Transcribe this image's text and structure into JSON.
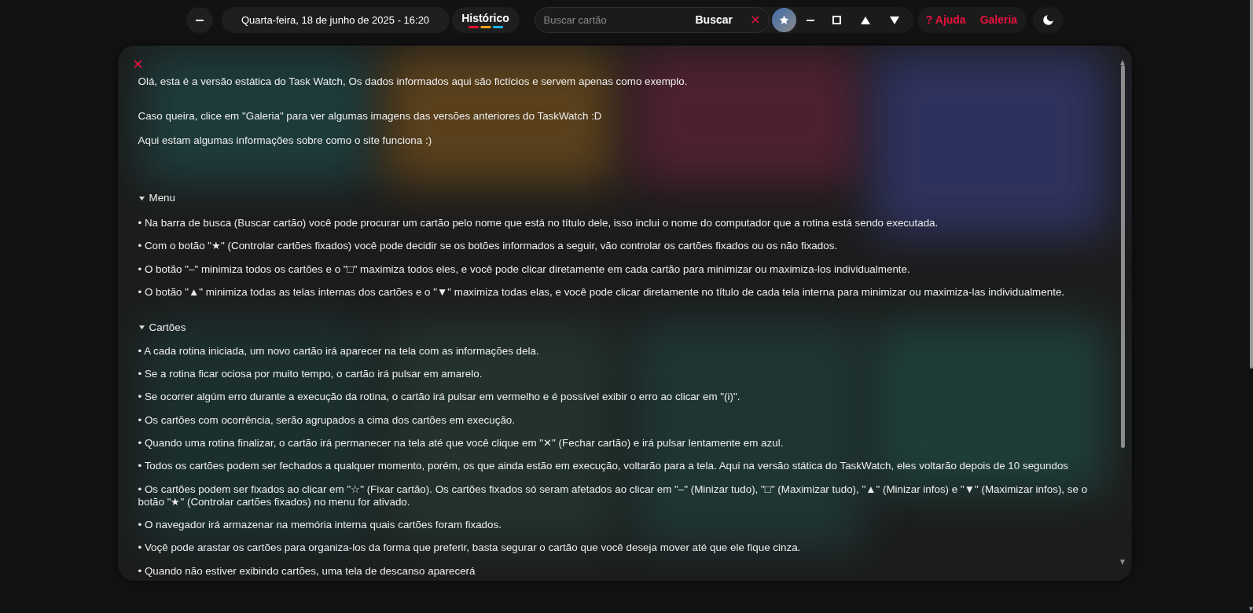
{
  "topbar": {
    "date": "Quarta-feira, 18 de junho de 2025 - 16:20",
    "history_button": "Histórico",
    "search": {
      "placeholder": "Buscar cartão",
      "button": "Buscar"
    },
    "help_link": "? Ajuda",
    "gallery_link": "Galeria"
  },
  "panel": {
    "intro": [
      "Olá, esta é a versão estática do Task Watch, Os dados informados aqui são fictícios e servem apenas como exemplo.",
      "Caso queira, clice em \"Galeria\" para ver algumas imagens das versões anteriores do TaskWatch :D",
      "Aqui estam algumas informações sobre como o site funciona :)"
    ],
    "sections": [
      {
        "title": "Menu",
        "expanded": true,
        "items": [
          "• Na barra de busca (Buscar cartão) você pode procurar um cartão pelo nome que está no título dele, isso inclui o nome do computador que a rotina está sendo executada.",
          "• Com o botão \"★\" (Controlar cartões fixados) você pode decidir se os botões informados a seguir, vão controlar os cartões fixados ou os não fixados.",
          "• O botão \"–\" minimiza todos os cartões e o \"□\" maximiza todos eles, e você pode clicar diretamente em cada cartão para minimizar ou maximiza-los individualmente.",
          "• O botão \"▲\" minimiza todas as telas internas dos cartões e o \"▼\" maximiza todas elas, e você pode clicar diretamente no título de cada tela interna para minimizar ou maximiza-las individualmente."
        ]
      },
      {
        "title": "Cartões",
        "expanded": true,
        "items": [
          "• A cada rotina iniciada, um novo cartão irá aparecer na tela com as informações dela.",
          "• Se a rotina ficar ociosa por muito tempo, o cartão irá pulsar em amarelo.",
          "• Se ocorrer algúm erro durante a execução da rotina, o cartão irá pulsar em vermelho e é possível exibir o erro ao clicar em \"(i)\".",
          "• Os cartões com ocorrência, serão agrupados a cima dos cartões em execução.",
          "• Quando uma rotina finalizar, o cartão irá permanecer na tela até que você clique em \"✕\" (Fechar cartão) e irá pulsar lentamente em azul.",
          "• Todos os cartões podem ser fechados a qualquer momento, porém, os que ainda estão em execução, voltarão para a tela. Aqui na versão stática do TaskWatch, eles voltarão depois de 10 segundos",
          "• Os cartões podem ser fixados ao clicar em \"☆\" (Fixar cartão). Os cartões fixados só seram afetados ao clicar em \"–\" (Minizar tudo), \"□\" (Maximizar tudo), \"▲\" (Minizar infos) e \"▼\" (Maximizar infos), se o botão \"★\" (Controlar cartões fixados) no menu for ativado.",
          "• O navegador irá armazenar na memória interna quais cartões foram fixados.",
          "• Voçê pode arastar os cartões para organiza-los da forma que preferir, basta segurar o cartão que você deseja mover até que ele fique cinza.",
          "• Quando não estiver exibindo cartões, uma tela de descanso aparecerá"
        ]
      }
    ]
  }
}
